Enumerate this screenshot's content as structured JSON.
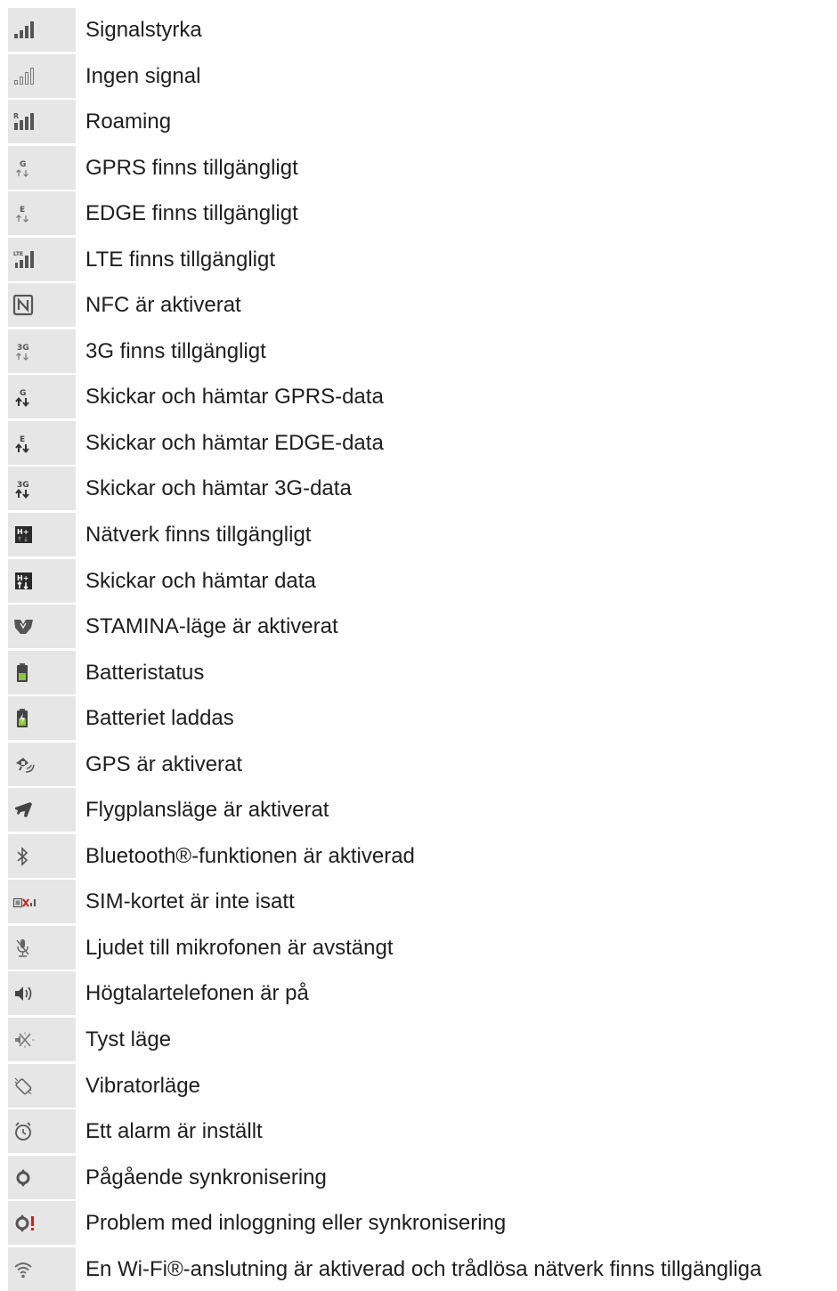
{
  "rows": [
    {
      "icon": "signal-strength-icon",
      "label": "Signalstyrka"
    },
    {
      "icon": "no-signal-icon",
      "label": "Ingen signal"
    },
    {
      "icon": "roaming-icon",
      "label": "Roaming"
    },
    {
      "icon": "gprs-available-icon",
      "icon_text": "G",
      "label": "GPRS finns tillgängligt"
    },
    {
      "icon": "edge-available-icon",
      "icon_text": "E",
      "label": "EDGE finns tillgängligt"
    },
    {
      "icon": "lte-available-icon",
      "icon_text": "LTE",
      "label": "LTE finns tillgängligt"
    },
    {
      "icon": "nfc-icon",
      "label": "NFC är aktiverat"
    },
    {
      "icon": "3g-available-icon",
      "icon_text": "3G",
      "label": "3G finns tillgängligt"
    },
    {
      "icon": "gprs-data-transfer-icon",
      "icon_text": "G",
      "label": "Skickar och hämtar GPRS-data"
    },
    {
      "icon": "edge-data-transfer-icon",
      "icon_text": "E",
      "label": "Skickar och hämtar EDGE-data"
    },
    {
      "icon": "3g-data-transfer-icon",
      "icon_text": "3G",
      "label": "Skickar och hämtar 3G-data"
    },
    {
      "icon": "network-available-icon",
      "icon_text": "H+",
      "label": "Nätverk finns tillgängligt"
    },
    {
      "icon": "data-transfer-icon",
      "icon_text": "H+",
      "label": "Skickar och hämtar data"
    },
    {
      "icon": "stamina-mode-icon",
      "label": "STAMINA-läge är aktiverat"
    },
    {
      "icon": "battery-status-icon",
      "label": "Batteristatus"
    },
    {
      "icon": "battery-charging-icon",
      "label": "Batteriet laddas"
    },
    {
      "icon": "gps-icon",
      "label": "GPS är aktiverat"
    },
    {
      "icon": "airplane-mode-icon",
      "label": "Flygplansläge är aktiverat"
    },
    {
      "icon": "bluetooth-icon",
      "label": "Bluetooth®-funktionen är aktiverad"
    },
    {
      "icon": "no-sim-icon",
      "label": "SIM-kortet är inte isatt"
    },
    {
      "icon": "microphone-muted-icon",
      "label": "Ljudet till mikrofonen är avstängt"
    },
    {
      "icon": "speakerphone-icon",
      "label": "Högtalartelefonen är på"
    },
    {
      "icon": "silent-mode-icon",
      "label": "Tyst läge"
    },
    {
      "icon": "vibrate-mode-icon",
      "label": "Vibratorläge"
    },
    {
      "icon": "alarm-icon",
      "label": "Ett alarm är inställt"
    },
    {
      "icon": "sync-icon",
      "label": "Pågående synkronisering"
    },
    {
      "icon": "sync-problem-icon",
      "label": "Problem med inloggning eller synkronisering"
    },
    {
      "icon": "wifi-icon",
      "label": "En Wi-Fi®-anslutning är aktiverad och trådlösa nätverk finns tillgängliga"
    }
  ]
}
